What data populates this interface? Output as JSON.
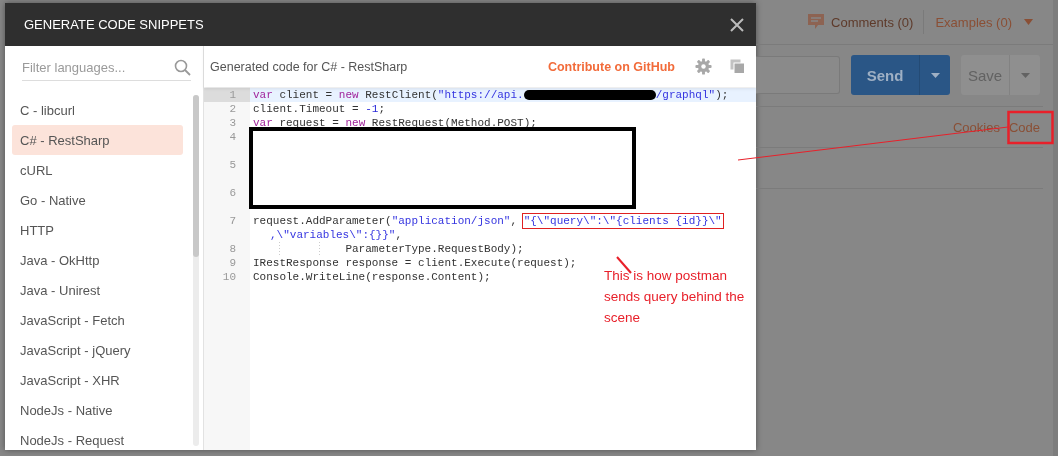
{
  "background": {
    "comments": "Comments (0)",
    "examples": "Examples (0)",
    "send": "Send",
    "save": "Save",
    "links": [
      "Cookies",
      "Code"
    ]
  },
  "dialog": {
    "title": "GENERATE CODE SNIPPETS",
    "filter": {
      "placeholder": "Filter languages..."
    },
    "languages": [
      {
        "label": "C - libcurl",
        "selected": false
      },
      {
        "label": "C# - RestSharp",
        "selected": true
      },
      {
        "label": "cURL",
        "selected": false
      },
      {
        "label": "Go - Native",
        "selected": false
      },
      {
        "label": "HTTP",
        "selected": false
      },
      {
        "label": "Java - OkHttp",
        "selected": false
      },
      {
        "label": "Java - Unirest",
        "selected": false
      },
      {
        "label": "JavaScript - Fetch",
        "selected": false
      },
      {
        "label": "JavaScript - jQuery",
        "selected": false
      },
      {
        "label": "JavaScript - XHR",
        "selected": false
      },
      {
        "label": "NodeJs - Native",
        "selected": false
      },
      {
        "label": "NodeJs - Request",
        "selected": false
      }
    ],
    "code_title": "Generated code for C# - RestSharp",
    "contribute_link": "Contribute on GitHub",
    "code_lines": [
      {
        "number": "1",
        "active": true,
        "covered": false,
        "tokens": [
          {
            "kind": "kw",
            "text": "var"
          },
          {
            "kind": "plain",
            "text": " client = "
          },
          {
            "kind": "kw",
            "text": "new"
          },
          {
            "kind": "plain",
            "text": " RestClient("
          },
          {
            "kind": "str",
            "text": "\"https://api."
          },
          {
            "kind": "redacted"
          },
          {
            "kind": "str",
            "text": "/graphql\""
          },
          {
            "kind": "plain",
            "text": ");"
          }
        ]
      },
      {
        "number": "2",
        "active": false,
        "covered": false,
        "tokens": [
          {
            "kind": "plain",
            "text": "client.Timeout = "
          },
          {
            "kind": "num",
            "text": "-1"
          },
          {
            "kind": "plain",
            "text": ";"
          }
        ]
      },
      {
        "number": "3",
        "active": false,
        "covered": false,
        "tokens": [
          {
            "kind": "kw",
            "text": "var"
          },
          {
            "kind": "plain",
            "text": " request = "
          },
          {
            "kind": "kw",
            "text": "new"
          },
          {
            "kind": "plain",
            "text": " RestRequest(Method.POST);"
          }
        ]
      },
      {
        "number": "4",
        "active": false,
        "covered": true
      },
      {
        "number": "5",
        "active": false,
        "covered": true
      },
      {
        "number": "6",
        "active": false,
        "covered": true
      },
      {
        "number": "7",
        "active": false,
        "covered": false,
        "tokens": [
          {
            "kind": "plain",
            "text": "request.AddParameter("
          },
          {
            "kind": "str",
            "text": "\"application/json\""
          },
          {
            "kind": "plain",
            "text": ", "
          },
          {
            "kind": "marked",
            "text": "\"{\\\"query\\\":\\\"{clients {id}}\\\""
          }
        ],
        "wrapped": [
          {
            "kind": "str",
            "text": ",\\\"variables\\\":{}}\""
          },
          {
            "kind": "plain",
            "text": ","
          }
        ]
      },
      {
        "number": "8",
        "active": false,
        "covered": false,
        "tokens": [
          {
            "kind": "indent"
          },
          {
            "kind": "plain",
            "text": "ParameterType.RequestBody);"
          }
        ]
      },
      {
        "number": "9",
        "active": false,
        "covered": false,
        "tokens": [
          {
            "kind": "plain",
            "text": "IRestResponse response = client.Execute(request);"
          }
        ]
      },
      {
        "number": "10",
        "active": false,
        "covered": false,
        "tokens": [
          {
            "kind": "plain",
            "text": "Console.WriteLine(response.Content);"
          }
        ]
      }
    ]
  },
  "annotation": {
    "text": "This is how postman sends query behind the scene"
  }
}
